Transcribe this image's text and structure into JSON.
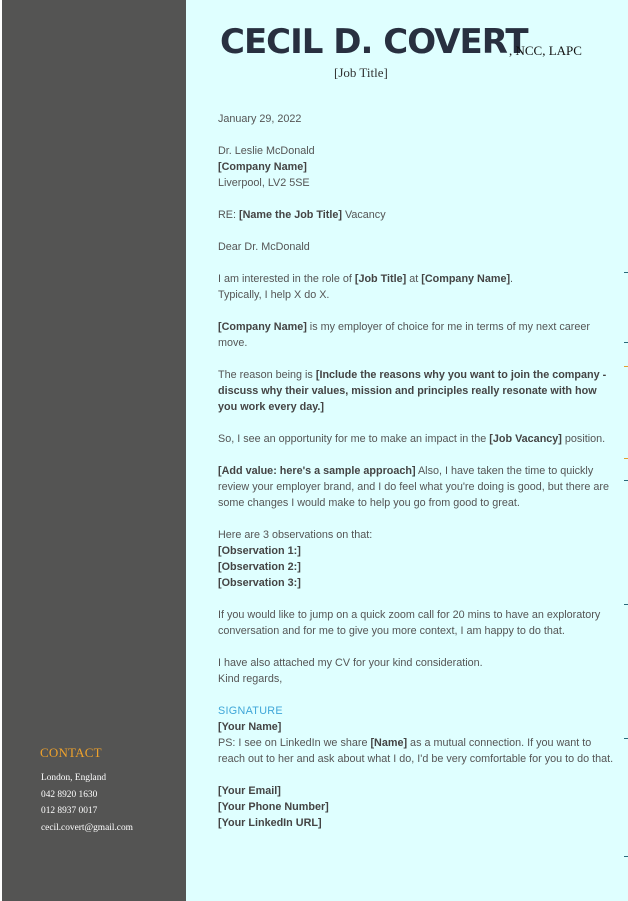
{
  "header": {
    "name": "CECIL D. COVERT",
    "credentials": ", NCC, LAPC",
    "job_title": "[Job Title]"
  },
  "contact": {
    "title": "CONTACT",
    "location": "London, England",
    "phone1": "042 8920 1630",
    "phone2": "012 8937 0017",
    "email": "cecil.covert@gmail.com"
  },
  "letter": {
    "date": "January 29, 2022",
    "recipient": "Dr. Leslie McDonald",
    "company": "[Company Name]",
    "address": "Liverpool, LV2 5SE",
    "re_prefix": "RE: ",
    "re_bold": "[Name the Job Title]",
    "re_suffix": " Vacancy",
    "salutation": "Dear Dr. McDonald",
    "p1_a": "I am interested in the role of ",
    "p1_b": "[Job Title]",
    "p1_c": " at ",
    "p1_d": "[Company Name]",
    "p1_e": ".",
    "p1_line2": "Typically, I help X do X.",
    "p2_a": "[Company Name]",
    "p2_b": " is my employer of choice for me in terms of my next career move.",
    "p3_a": "The reason being is ",
    "p3_b": "[Include the reasons why you want to join the company - discuss why their values, mission and principles really resonate with how you work every day.]",
    "p4_a": "So, I see an opportunity for me to make an impact in the ",
    "p4_b": "[Job Vacancy]",
    "p4_c": " position.",
    "p5_a": "[Add value: here's a sample approach]",
    "p5_b": " Also, I have taken the time to quickly review your employer brand, and I do feel what you're doing is good, but there are some changes I would make to help you go from good to great.",
    "obs_intro": "Here are 3 observations on that:",
    "obs1": "[Observation 1:]",
    "obs2": "[Observation 2:]",
    "obs3": "[Observation 3:]",
    "p6": "If you would like to jump on a quick zoom call for 20 mins to have an exploratory conversation and for me to give you more context, I am happy to do that.",
    "p7_line1": "I have also attached my CV for your kind consideration.",
    "p7_line2": "Kind regards,",
    "signature_label": "SIGNATURE",
    "your_name": "[Your Name]",
    "ps_a": "PS: I see on LinkedIn we share ",
    "ps_b": "[Name]",
    "ps_c": " as a mutual connection. If you want to reach out to her and ask about what I do, I'd be very comfortable for you to do that.",
    "your_email": "[Your Email]",
    "your_phone": "[Your Phone Number]",
    "your_linkedin": "[Your LinkedIn URL]"
  }
}
